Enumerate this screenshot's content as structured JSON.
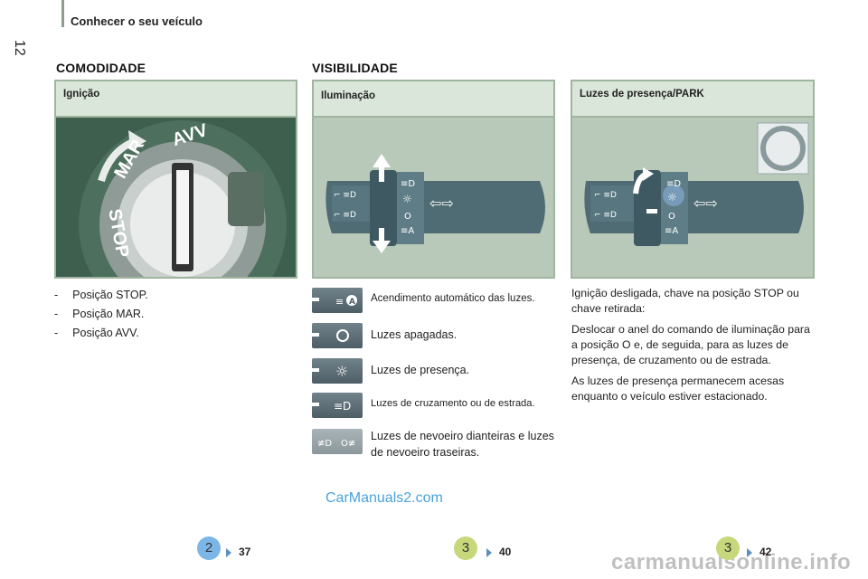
{
  "header": {
    "title": "Conhecer o seu veículo",
    "page_number": "12"
  },
  "sections": {
    "left": "COMODIDADE",
    "right": "VISIBILIDADE"
  },
  "panels": {
    "ignicao": {
      "title": "Ignição"
    },
    "iluminacao": {
      "title": "Iluminação"
    },
    "presenca": {
      "title": "Luzes de presença/PARK"
    }
  },
  "ignition_positions": [
    "Posição STOP.",
    "Posição MAR.",
    "Posição AVV."
  ],
  "ignition_ring_labels": [
    "AVV",
    "MAR",
    "STOP"
  ],
  "lighting_legend": [
    "Acendimento automático das luzes.",
    "Luzes apagadas.",
    "Luzes de presença.",
    "Luzes de cruzamento ou de estrada.",
    "Luzes de nevoeiro dianteiras e luzes de nevoeiro traseiras."
  ],
  "presenca_text": [
    "Ignição desligada, chave na posição STOP ou chave retirada:",
    "Deslocar o anel do comando de iluminação para a posição O e, de seguida, para as luzes de presença, de cruzamento ou de estrada.",
    "As luzes de presença permanecem acesas enquanto o veículo estiver estacionado."
  ],
  "watermark": "CarManuals2.com",
  "footer_watermark": "carmanualsonline.info",
  "refs": [
    {
      "badge": "2",
      "page": "37",
      "color": "#7cb6e6"
    },
    {
      "badge": "3",
      "page": "40",
      "color": "#c7d77b"
    },
    {
      "badge": "3",
      "page": "42",
      "color": "#c7d77b"
    }
  ]
}
